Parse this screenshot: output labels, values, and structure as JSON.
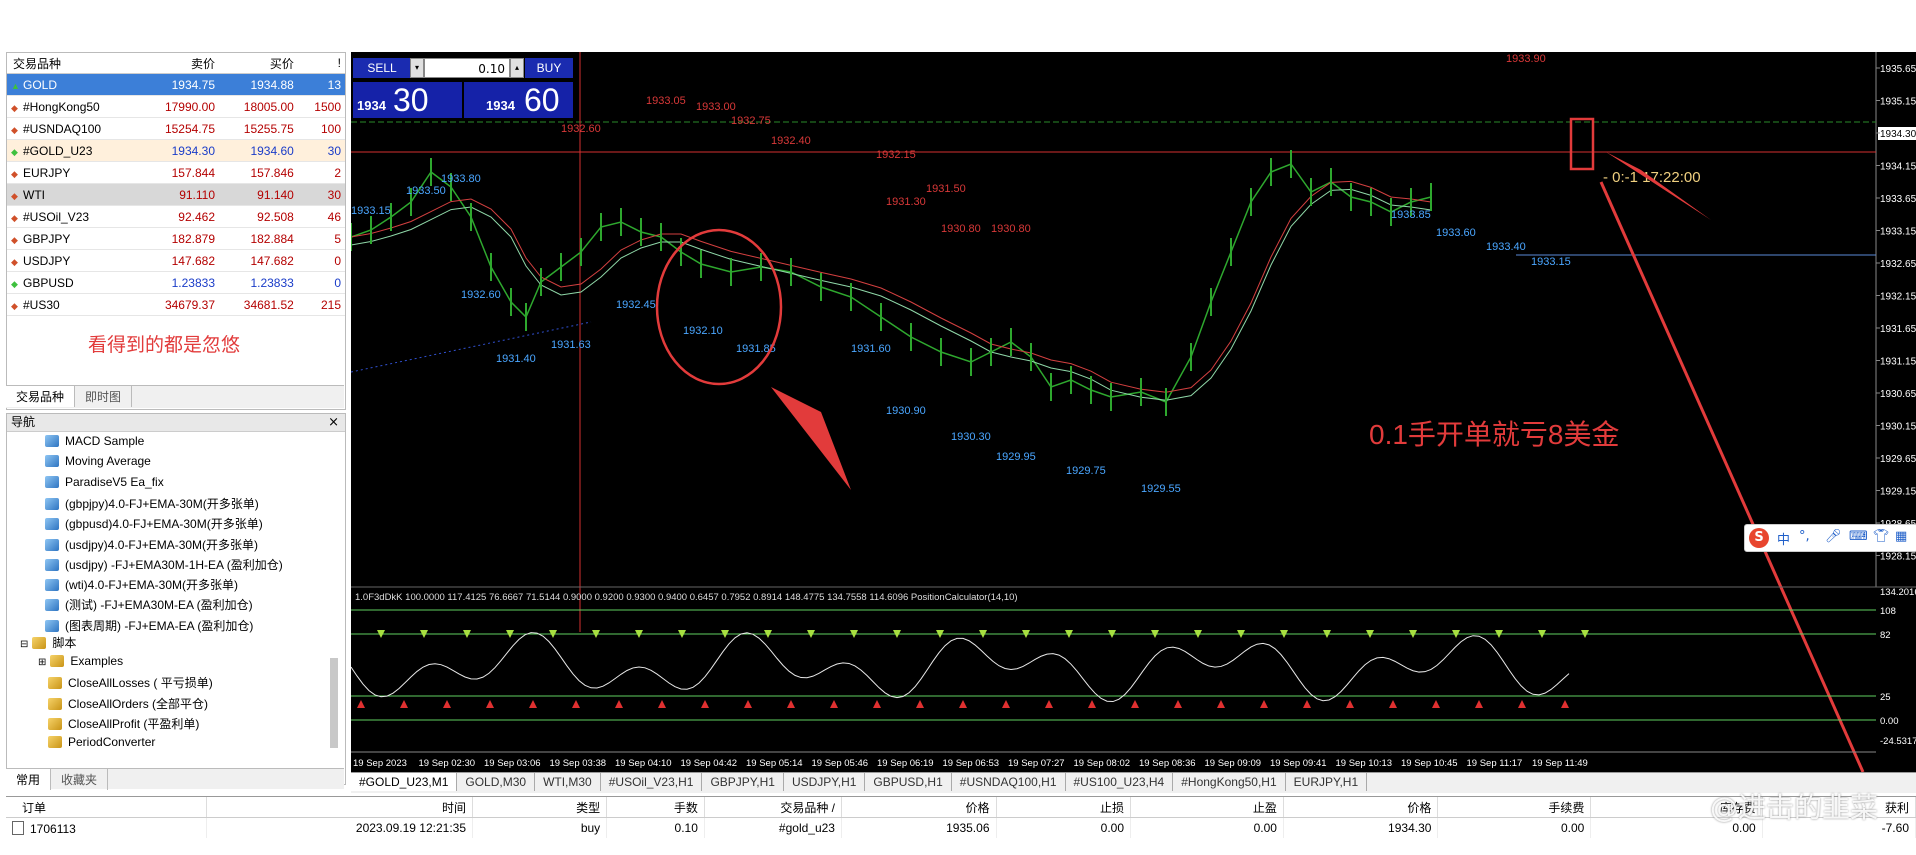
{
  "market_watch": {
    "headers": {
      "symbol": "交易品种",
      "bid": "卖价",
      "ask": "买价",
      "spread": "!"
    },
    "rows": [
      {
        "symbol": "GOLD",
        "bid": "1934.75",
        "ask": "1934.88",
        "spread": "13"
      },
      {
        "symbol": "#HongKong50",
        "bid": "17990.00",
        "ask": "18005.00",
        "spread": "1500"
      },
      {
        "symbol": "#USNDAQ100",
        "bid": "15254.75",
        "ask": "15255.75",
        "spread": "100"
      },
      {
        "symbol": "#GOLD_U23",
        "bid": "1934.30",
        "ask": "1934.60",
        "spread": "30"
      },
      {
        "symbol": "EURJPY",
        "bid": "157.844",
        "ask": "157.846",
        "spread": "2"
      },
      {
        "symbol": "WTI",
        "bid": "91.110",
        "ask": "91.140",
        "spread": "30"
      },
      {
        "symbol": "#USOil_V23",
        "bid": "92.462",
        "ask": "92.508",
        "spread": "46"
      },
      {
        "symbol": "GBPJPY",
        "bid": "182.879",
        "ask": "182.884",
        "spread": "5"
      },
      {
        "symbol": "USDJPY",
        "bid": "147.682",
        "ask": "147.682",
        "spread": "0"
      },
      {
        "symbol": "GBPUSD",
        "bid": "1.23833",
        "ask": "1.23833",
        "spread": "0"
      },
      {
        "symbol": "#US30",
        "bid": "34679.37",
        "ask": "34681.52",
        "spread": "215"
      }
    ],
    "note": "看得到的都是忽悠",
    "tabs": [
      "交易品种",
      "即时图"
    ]
  },
  "navigator": {
    "title": "导航",
    "ea_items": [
      "MACD Sample",
      "Moving Average",
      "ParadiseV5 Ea_fix",
      "(gbpjpy)4.0-FJ+EMA-30M(开多张单)",
      "(gbpusd)4.0-FJ+EMA-30M(开多张单)",
      "(usdjpy)4.0-FJ+EMA-30M(开多张单)",
      "(usdjpy)  -FJ+EMA30M-1H-EA  (盈利加仓)",
      "(wti)4.0-FJ+EMA-30M(开多张单)",
      "(测试)  -FJ+EMA30M-EA  (盈利加仓)",
      "(图表周期)  -FJ+EMA-EA  (盈利加仓)"
    ],
    "scripts_label": "脚本",
    "script_items": [
      "Examples",
      "CloseAllLosses  ( 平亏损单)",
      "CloseAllOrders  (全部平仓)",
      "CloseAllProfit  (平盈利单)",
      "PeriodConverter"
    ],
    "tabs": [
      "常用",
      "收藏夹"
    ]
  },
  "trade_panel": {
    "sell": "SELL",
    "buy": "BUY",
    "lot": "0.10",
    "sell_small": "1934",
    "sell_big": "30",
    "buy_small": "1934",
    "buy_big": "60"
  },
  "chart": {
    "price_labels": [
      "1935.65",
      "1935.15",
      "1934.30",
      "1934.15",
      "1933.65",
      "1933.15",
      "1932.65",
      "1932.15",
      "1931.65",
      "1931.15",
      "1930.65",
      "1930.15",
      "1929.65",
      "1929.15",
      "1928.65",
      "1928.15"
    ],
    "red_annotations": [
      "1933.90",
      "1933.05",
      "1933.00",
      "1933.00",
      "1932.60",
      "1932.75",
      "1932.40",
      "1932.15",
      "1931.50",
      "1931.30",
      "1930.80",
      "1930.80"
    ],
    "blue_annotations": [
      "1933.80",
      "1933.50",
      "1933.15",
      "1932.60",
      "1931.40",
      "1931.63",
      "1932.45",
      "1932.10",
      "1931.85",
      "1931.60",
      "1930.90",
      "1930.30",
      "1929.95",
      "1929.75",
      "1929.55",
      "1933.85",
      "1933.60",
      "1933.40",
      "1933.15"
    ],
    "countdown": "- 0:-1  17:22:00",
    "big_note": "0.1手开单就亏8美金",
    "indicator_header": "1.0F3dDkK 100.0000 117.4125 76.6667 71.5144 0.9000 0.9200 0.9300 0.9400 0.6457 0.7952 0.8914 148.4775 134.7558 114.6096  PositionCalculator(14,10)",
    "indicator_levels": [
      "134.2016",
      "108",
      "82",
      "25",
      "0.00",
      "-24.5317"
    ],
    "time_labels": [
      "19 Sep 2023",
      "19 Sep 02:30",
      "19 Sep 03:06",
      "19 Sep 03:38",
      "19 Sep 04:10",
      "19 Sep 04:42",
      "19 Sep 05:14",
      "19 Sep 05:46",
      "19 Sep 06:19",
      "19 Sep 06:53",
      "19 Sep 07:27",
      "19 Sep 08:02",
      "19 Sep 08:36",
      "19 Sep 09:09",
      "19 Sep 09:41",
      "19 Sep 10:13",
      "19 Sep 10:45",
      "19 Sep 11:17",
      "19 Sep 11:49"
    ]
  },
  "symbol_tabs": [
    "#GOLD_U23,M1",
    "GOLD,M30",
    "WTI,M30",
    "#USOil_V23,H1",
    "GBPJPY,H1",
    "USDJPY,H1",
    "GBPUSD,H1",
    "#USNDAQ100,H1",
    "#US100_U23,H4",
    "#HongKong50,H1",
    "EURJPY,H1"
  ],
  "orders": {
    "headers": [
      "订单",
      "时间",
      "类型",
      "手数",
      "交易品种 /",
      "价格",
      "止损",
      "止盈",
      "价格",
      "手续费",
      "库存费",
      "获利"
    ],
    "row": [
      "1706113",
      "2023.09.19 12:21:35",
      "buy",
      "0.10",
      "#gold_u23",
      "1935.06",
      "0.00",
      "0.00",
      "1934.30",
      "0.00",
      "0.00",
      "-7.60"
    ]
  },
  "watermark": "@进击的韭菜",
  "ime": {
    "logo": "S",
    "lang": "中"
  },
  "colors": {
    "accent_red": "#e23b3b",
    "chart_bg": "#000000",
    "trade_blue": "#1a2bb0"
  }
}
